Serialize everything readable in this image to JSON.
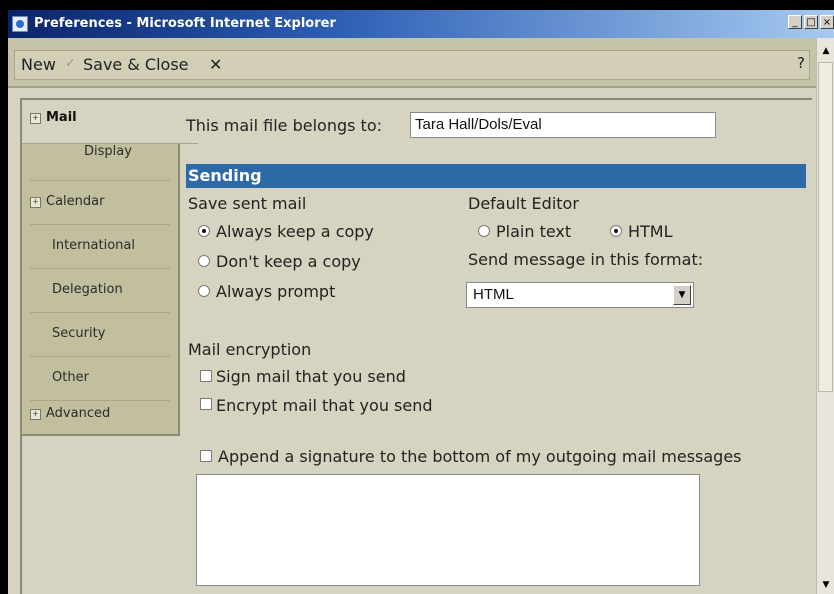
{
  "window": {
    "title": "Preferences - Microsoft Internet Explorer",
    "controls": {
      "minimize": "_",
      "maximize": "□",
      "close": "×"
    }
  },
  "toolbar": {
    "new_label": "New",
    "save_close_label": "Save & Close",
    "close_glyph": "✕",
    "help_label": "?"
  },
  "nav": {
    "mail": "Mail",
    "display": "Display",
    "calendar": "Calendar",
    "international": "International",
    "delegation": "Delegation",
    "security": "Security",
    "other": "Other",
    "advanced": "Advanced",
    "expand_glyph": "+"
  },
  "main": {
    "owner_label": "This mail file belongs to:",
    "owner_value": "Tara Hall/Dols/Eval",
    "section_title": "Sending",
    "save_sent_label": "Save sent mail",
    "save_options": [
      "Always keep a copy",
      "Don't keep a copy",
      "Always prompt"
    ],
    "save_selected": "Always keep a copy",
    "default_editor_label": "Default Editor",
    "editor_options": [
      "Plain text",
      "HTML"
    ],
    "editor_selected": "HTML",
    "format_label": "Send message in this format:",
    "format_value": "HTML",
    "encryption_label": "Mail encryption",
    "sign_label": "Sign mail that you send",
    "encrypt_label": "Encrypt mail that you send",
    "signature_label": "Append a signature to the bottom of my outgoing mail messages"
  },
  "scrollbar": {
    "up": "▲",
    "down": "▼"
  },
  "colors": {
    "section_bar": "#2f6aa8",
    "titlebar": "#0a246a",
    "background": "#d6d3c0"
  }
}
